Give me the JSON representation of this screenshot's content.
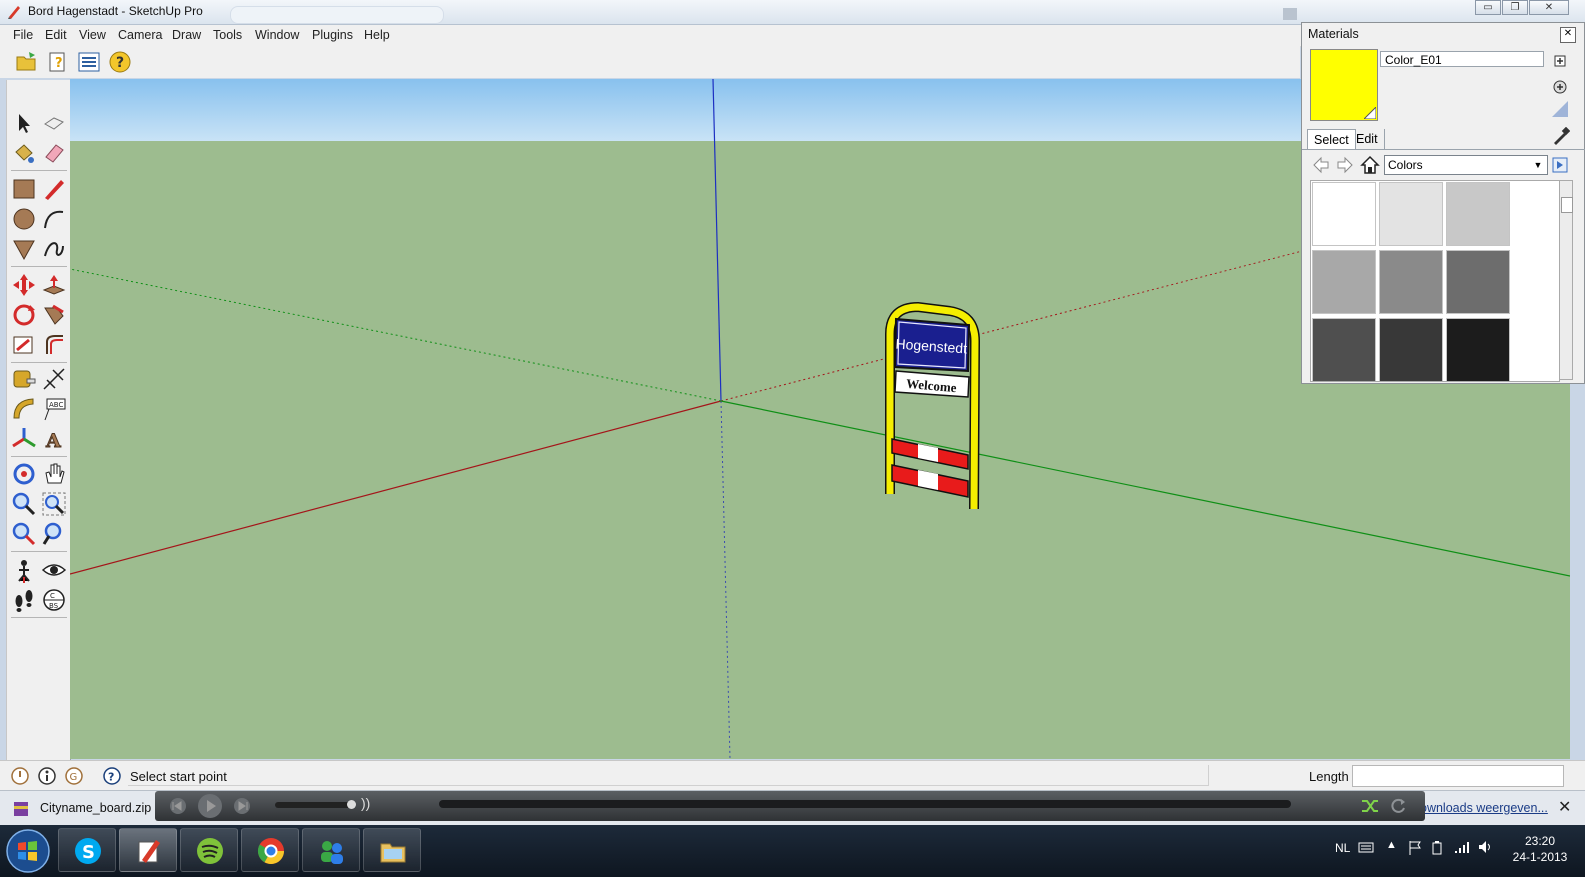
{
  "window": {
    "title": "Bord Hagenstadt - SketchUp Pro",
    "minimize": "▭",
    "restore": "❐",
    "close": "✕"
  },
  "menu": [
    "File",
    "Edit",
    "View",
    "Camera",
    "Draw",
    "Tools",
    "Window",
    "Plugins",
    "Help"
  ],
  "viewport": {
    "sign_title": "Hogenstedt",
    "sign_subtitle": "Welcome",
    "sky_color": "#a9d3f3",
    "ground_color": "#9dbc8f",
    "sign_frame_color": "#f5ee00"
  },
  "status": {
    "message": "Select start point",
    "length_label": "Length",
    "length_value": ""
  },
  "materials": {
    "title": "Materials",
    "material_name": "Color_E01",
    "swatch_color": "#ffff00",
    "tabs": [
      "Select",
      "Edit"
    ],
    "library": "Colors",
    "colors": [
      "#ffffff",
      "#e3e3e3",
      "#c8c8c8",
      "#a8a8a8",
      "#8a8a8a",
      "#6d6d6d",
      "#4f4f4f",
      "#383838",
      "#1c1c1c"
    ]
  },
  "download": {
    "file": "Cityname_board.zip",
    "show_all": "ownloads weergeven..."
  },
  "taskbar": {
    "language": "NL",
    "time": "23:20",
    "date": "24-1-2013"
  }
}
